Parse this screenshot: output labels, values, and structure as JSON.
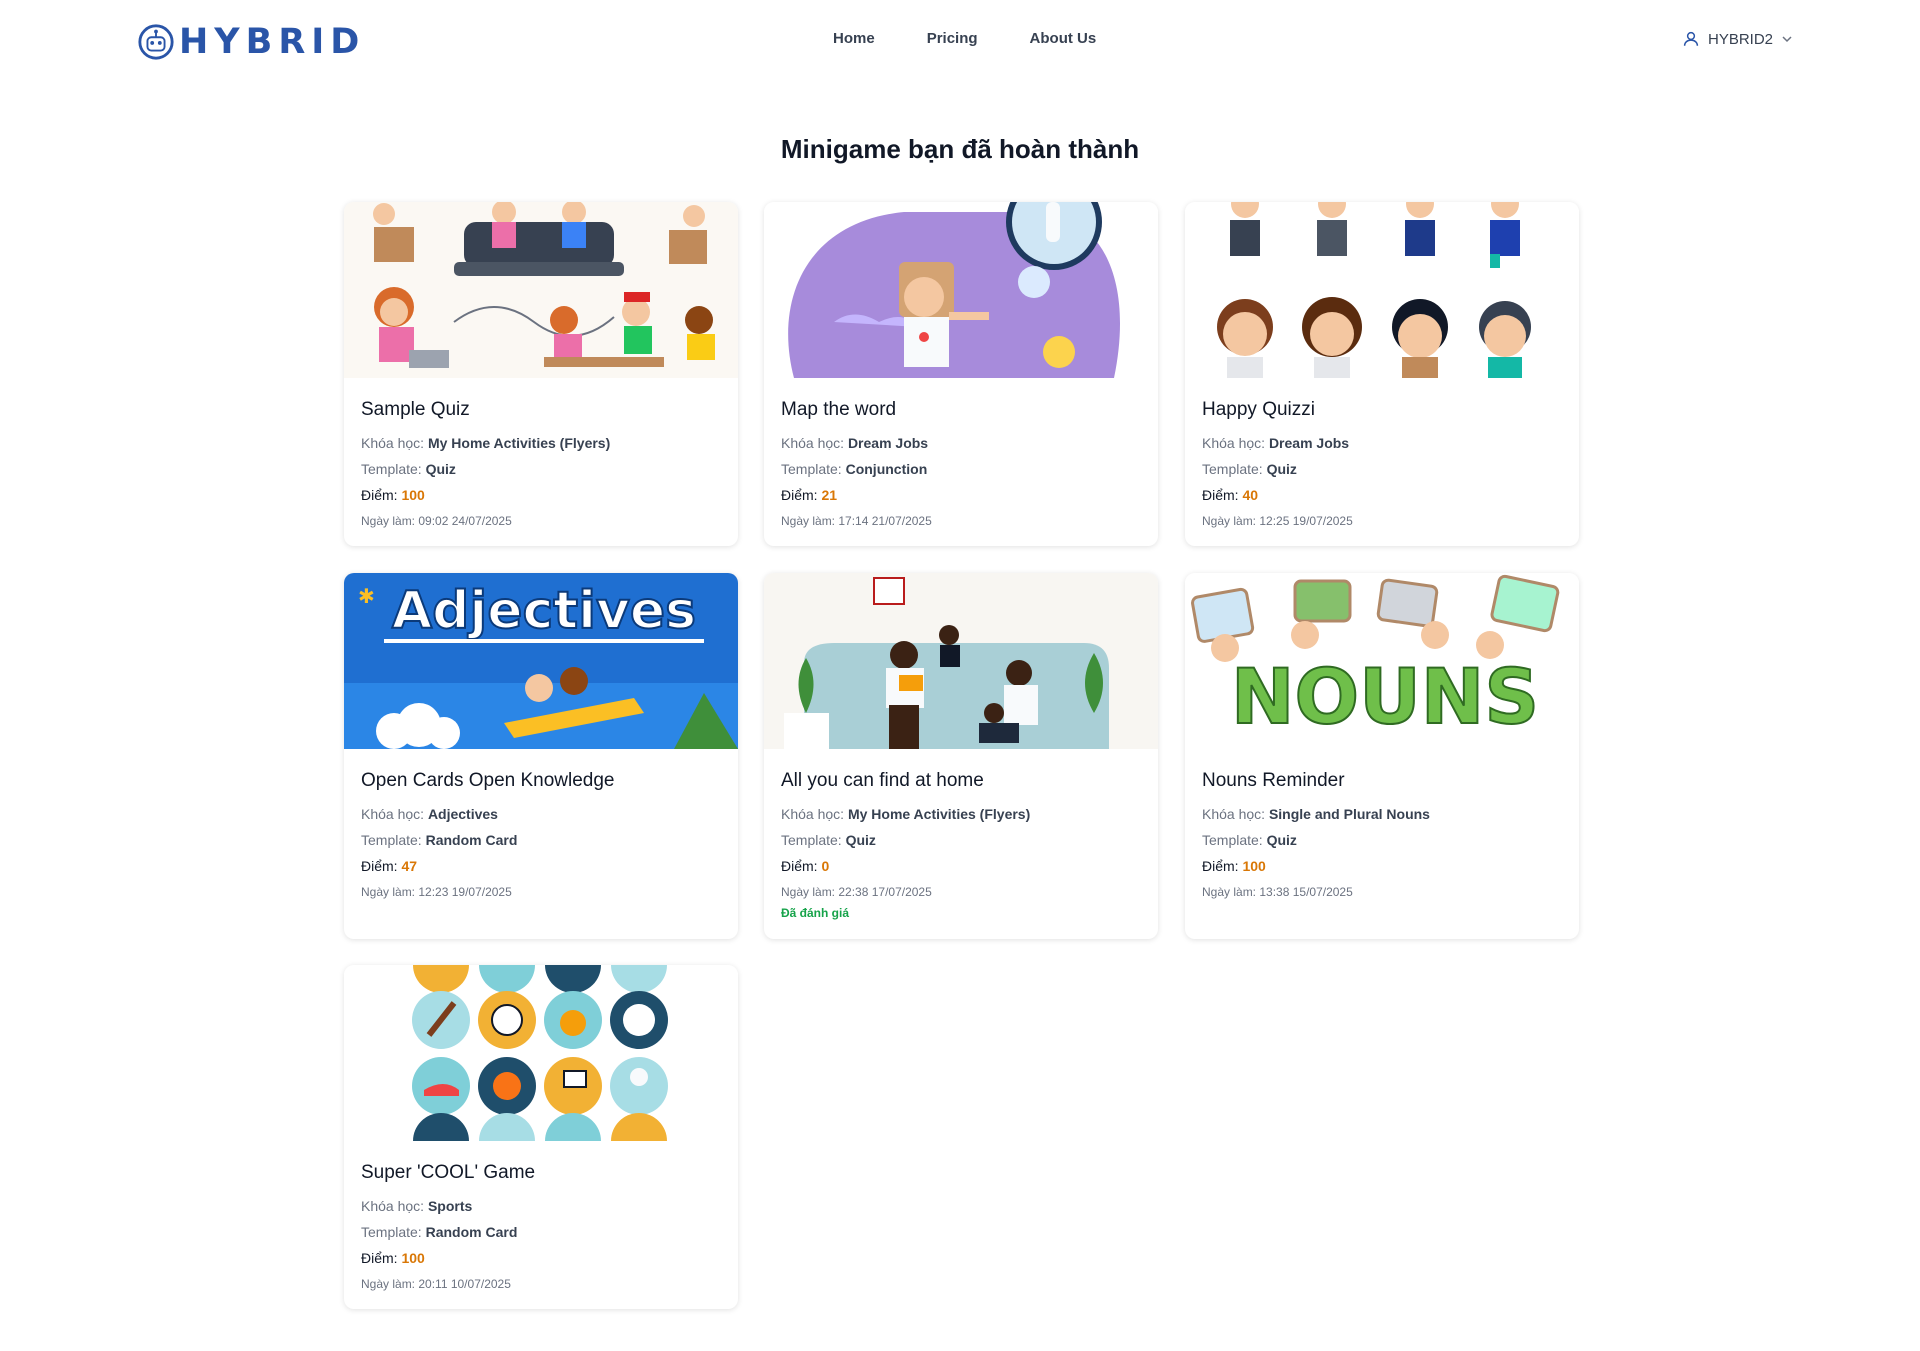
{
  "header": {
    "logo_text": "HYBRID",
    "nav": [
      "Home",
      "Pricing",
      "About Us"
    ],
    "user": "HYBRID2"
  },
  "page": {
    "title": "Minigame bạn đã hoàn thành"
  },
  "labels": {
    "course": "Khóa học: ",
    "template": "Template: ",
    "score": "Điểm: ",
    "date": "Ngày làm: "
  },
  "cards": [
    {
      "title": "Sample Quiz",
      "course": "My Home Activities (Flyers)",
      "template": "Quiz",
      "score": "100",
      "date": "09:02 24/07/2025",
      "thumb": "kids-laptops-illustration"
    },
    {
      "title": "Map the word",
      "course": "Dream Jobs",
      "template": "Conjunction",
      "score": "21",
      "date": "17:14 21/07/2025",
      "thumb": "astronaut-kid-illustration"
    },
    {
      "title": "Happy Quizzi",
      "course": "Dream Jobs",
      "template": "Quiz",
      "score": "40",
      "date": "12:25 19/07/2025",
      "thumb": "professions-characters"
    },
    {
      "title": "Open Cards Open Knowledge",
      "course": "Adjectives",
      "template": "Random Card",
      "score": "47",
      "date": "12:23 19/07/2025",
      "thumb": "adjectives-banner",
      "thumb_text": "Adjectives"
    },
    {
      "title": "All you can find at home",
      "course": "My Home Activities (Flyers)",
      "template": "Quiz",
      "score": "0",
      "date": "22:38 17/07/2025",
      "status": "Đã đánh giá",
      "thumb": "family-living-room"
    },
    {
      "title": "Nouns Reminder",
      "course": "Single and Plural Nouns",
      "template": "Quiz",
      "score": "100",
      "date": "13:38 15/07/2025",
      "thumb": "nouns-banner",
      "thumb_text": "NOUNS"
    },
    {
      "title": "Super 'COOL' Game",
      "course": "Sports",
      "template": "Random Card",
      "score": "100",
      "date": "20:11 10/07/2025",
      "thumb": "sports-icons-grid"
    }
  ],
  "colors": {
    "brand": "#2a55a8",
    "score": "#d97706",
    "status": "#16a34a"
  }
}
